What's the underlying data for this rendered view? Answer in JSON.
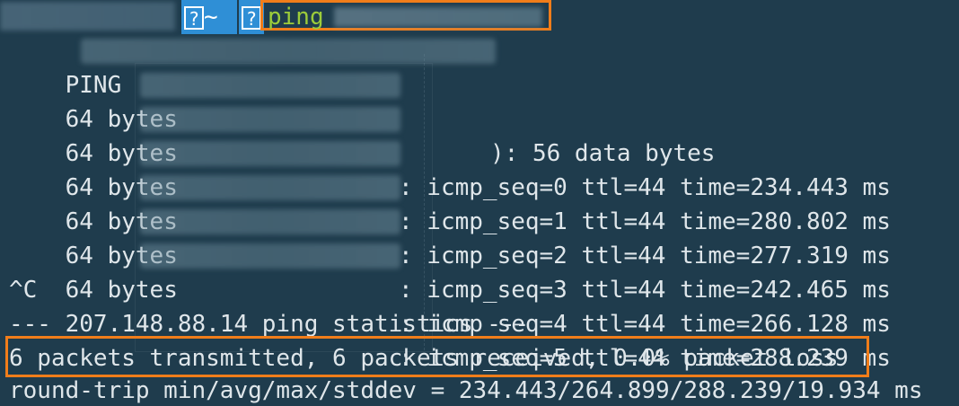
{
  "prompt": {
    "dir_icon": "?",
    "dir": "~",
    "arrow_icon": "?",
    "command": "ping"
  },
  "output": {
    "ping_header_prefix": "PING",
    "ping_header_suffix": "): 56 data bytes",
    "replies": [
      {
        "prefix": "64 bytes",
        "detail": ": icmp_seq=0 ttl=44 time=234.443 ms"
      },
      {
        "prefix": "64 bytes",
        "detail": ": icmp_seq=1 ttl=44 time=280.802 ms"
      },
      {
        "prefix": "64 bytes",
        "detail": ": icmp_seq=2 ttl=44 time=277.319 ms"
      },
      {
        "prefix": "64 bytes",
        "detail": ": icmp_seq=3 ttl=44 time=242.465 ms"
      },
      {
        "prefix": "64 bytes",
        "detail": ": icmp_seq=4 ttl=44 time=266.128 ms"
      },
      {
        "prefix": "64 bytes",
        "detail": ": icmp_seq=5 ttl=44 time=288.239 ms"
      }
    ],
    "interrupt": "^C",
    "stats_header": "--- 207.148.88.14 ping statistics ---",
    "stats_summary": "6 packets transmitted, 6 packets received, 0.0% packet loss",
    "round_trip": "round-trip min/avg/max/stddev = 234.443/264.899/288.239/19.934 ms"
  },
  "colors": {
    "background": "#1f3c4d",
    "text": "#dfe6ea",
    "command": "#9ccc3a",
    "prompt_segment": "#2f8fd6",
    "highlight_border": "#f07d1a"
  }
}
